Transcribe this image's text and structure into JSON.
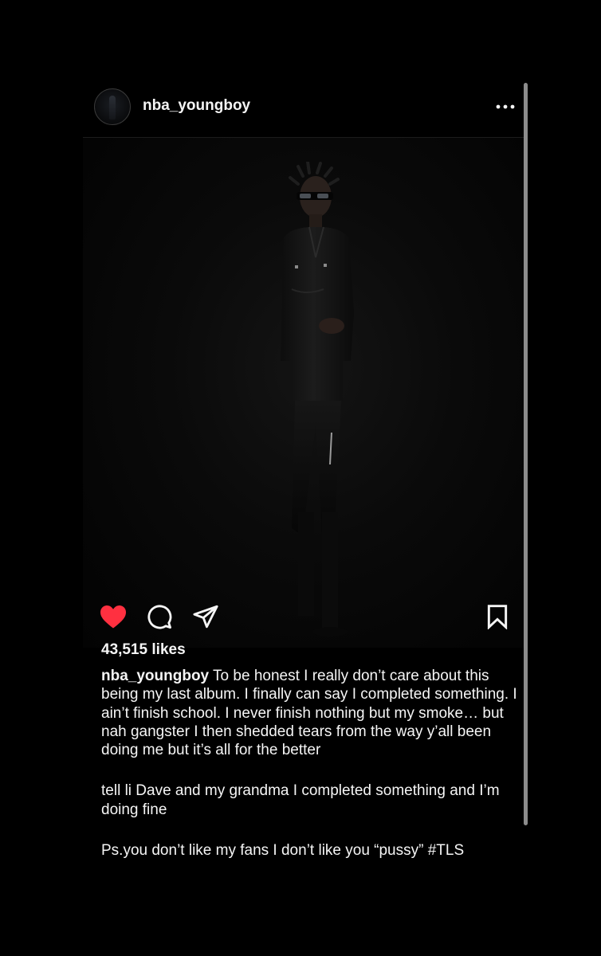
{
  "post": {
    "username": "nba_youngboy",
    "more_icon": "more-horizontal-icon",
    "image_alt": "Photo of a person in dark clothing standing against a black background",
    "liked": true,
    "like_color": "#ff3040",
    "likes_text": "43,515 likes",
    "caption": {
      "username": "nba_youngboy",
      "paragraph1": " To be honest I really don’t care about this being my last album. I finally can say I completed something. I ain’t finish school. I never finish nothing but my smoke… but nah gangster I then shedded tears from the way y’all been doing me but it’s all for the better",
      "paragraph2": "tell li Dave and my grandma I completed something and I’m doing fine",
      "paragraph3": "Ps.you don’t like my fans I don’t like you “pussy” ",
      "hashtag": "#TLS"
    },
    "icons": {
      "like": "heart-icon",
      "comment": "comment-icon",
      "share": "share-icon",
      "save": "bookmark-icon"
    }
  },
  "colors": {
    "background": "#000000",
    "text": "#f5f5f5",
    "scrollbar": "#8c8c8c"
  }
}
